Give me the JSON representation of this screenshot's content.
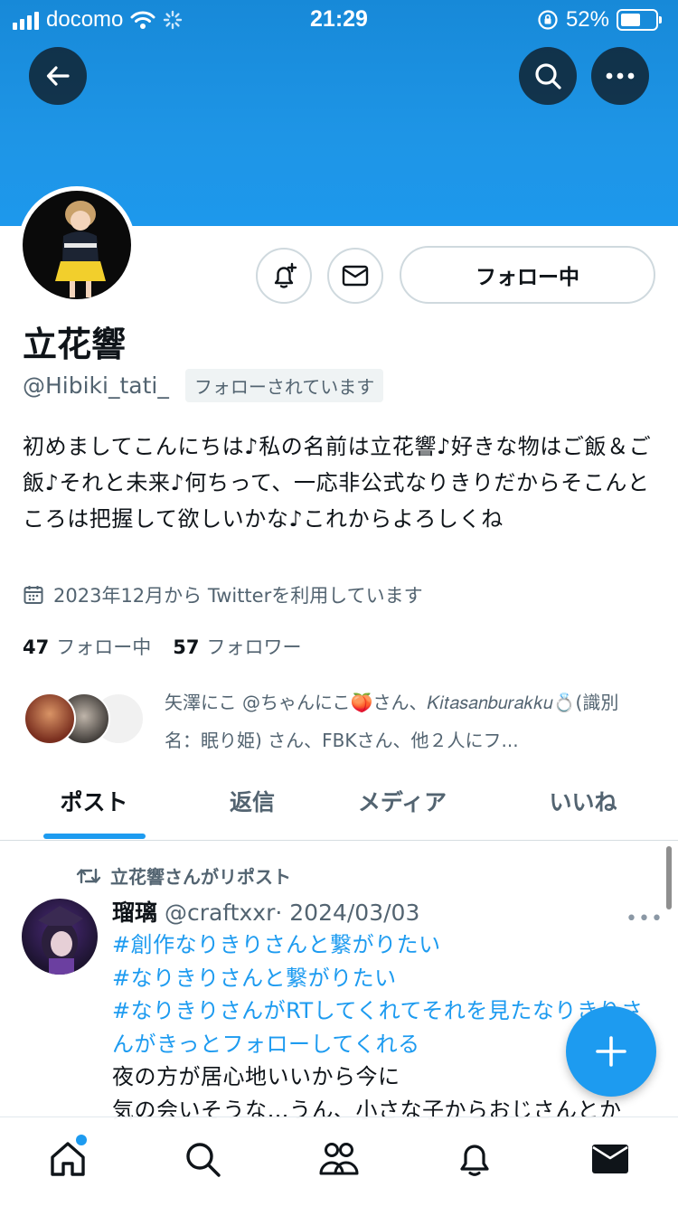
{
  "status_bar": {
    "carrier": "docomo",
    "time": "21:29",
    "battery": "52%"
  },
  "profile": {
    "name": "立花響",
    "handle": "@Hibiki_tati_",
    "follows_you": "フォローされています",
    "follow_button": "フォロー中",
    "bio": "初めましてこんにちは♪私の名前は立花響♪好きな物はご飯＆ご飯♪それと未来♪何ちって、一応非公式なりきりだからそこんところは把握して欲しいかな♪これからよろしくね",
    "joined": "2023年12月から Twitterを利用しています",
    "following_count": "47",
    "following_label": "フォロー中",
    "followers_count": "57",
    "followers_label": "フォロワー",
    "followed_by": "矢澤にこ @ちゃんにこ🍑さん、𝐾𝑖𝑡𝑎𝑠𝑎𝑛𝑏𝑢𝑟𝑎𝑘𝑘𝑢💍(識別名：眠り姫) さん、FBKさん、他２人にフ..."
  },
  "tabs": [
    "ポスト",
    "返信",
    "メディア",
    "いいね"
  ],
  "post": {
    "repost_label": "立花響さんがリポスト",
    "author": "瑠璃",
    "handle": "@craftxxr",
    "date": "· 2024/03/03",
    "more": "•••",
    "hashtags": [
      "#創作なりきりさんと繋がりたい",
      "#なりきりさんと繋がりたい",
      "#なりきりさんがRTしてくれてそれを見たなりきりさんがきっとフォローしてくれる"
    ],
    "text_lines": [
      "夜の方が居心地いいから今に",
      "気の会いそうな…うん、小さな子からおじさんとか"
    ]
  },
  "colors": {
    "accent": "#1d9bf0",
    "banner": "#1d95e6",
    "text": "#0f1419",
    "secondary": "#536471"
  },
  "icons": {
    "back": "arrow-left-icon",
    "search": "search-icon",
    "more": "more-icon",
    "notify": "bell-plus-icon",
    "message": "envelope-icon",
    "calendar": "calendar-icon",
    "repost": "repost-icon",
    "compose": "plus-icon",
    "nav": [
      "home-icon",
      "search-icon",
      "communities-icon",
      "notifications-icon",
      "messages-icon"
    ]
  }
}
